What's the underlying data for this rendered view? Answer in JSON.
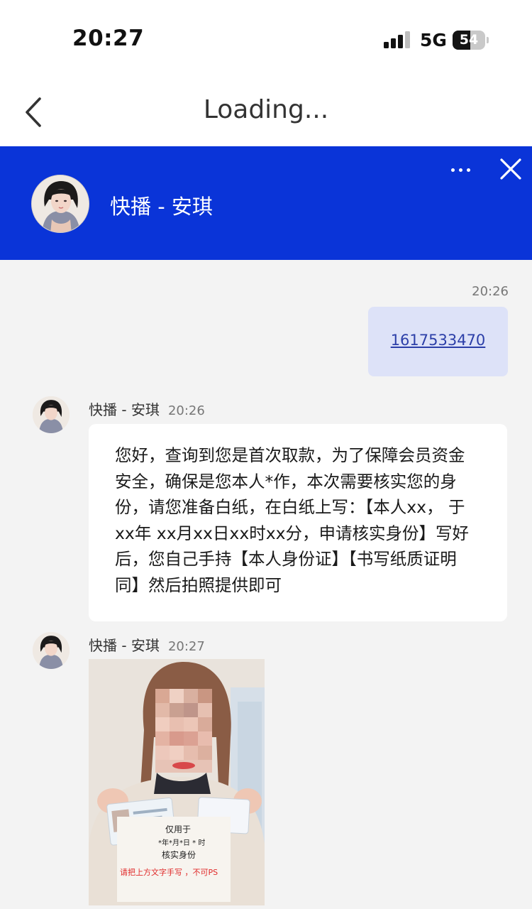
{
  "status_bar": {
    "time": "20:27",
    "network": "5G",
    "battery": "54",
    "battery_level": 0.54
  },
  "nav": {
    "title": "Loading..."
  },
  "chat_header": {
    "name": "快播 - 安琪"
  },
  "messages": [
    {
      "type": "sent",
      "time": "20:26",
      "text": "1617533470"
    },
    {
      "type": "received",
      "sender": "快播 - 安琪",
      "time": "20:26",
      "text": "您好，查询到您是首次取款，为了保障会员资金\n安全，确保是您本人*作，本次需要核实您的身\n份，请您准备白纸，在白纸上写：【本人xx， 于\nxx年 xx月xx日xx时xx分，申请核实身份】写好\n后，您自己手持【本人身份证】【书写纸质证明\n同】然后拍照提供即可"
    },
    {
      "type": "received_image",
      "sender": "快播 - 安琪",
      "time": "20:27",
      "note_lines": [
        "仅用于",
        "*年*月*日 * 时",
        "核实身份"
      ],
      "caption": "请把上方文字手写 ，不可PS"
    }
  ],
  "colors": {
    "header_blue": "#0a34d8",
    "sent_bubble": "#dde2f8",
    "link": "#2c3fa8",
    "chat_bg": "#f3f3f3"
  },
  "icons": {
    "back": "chevron-left-icon",
    "more": "ellipsis-icon",
    "close": "close-icon"
  }
}
